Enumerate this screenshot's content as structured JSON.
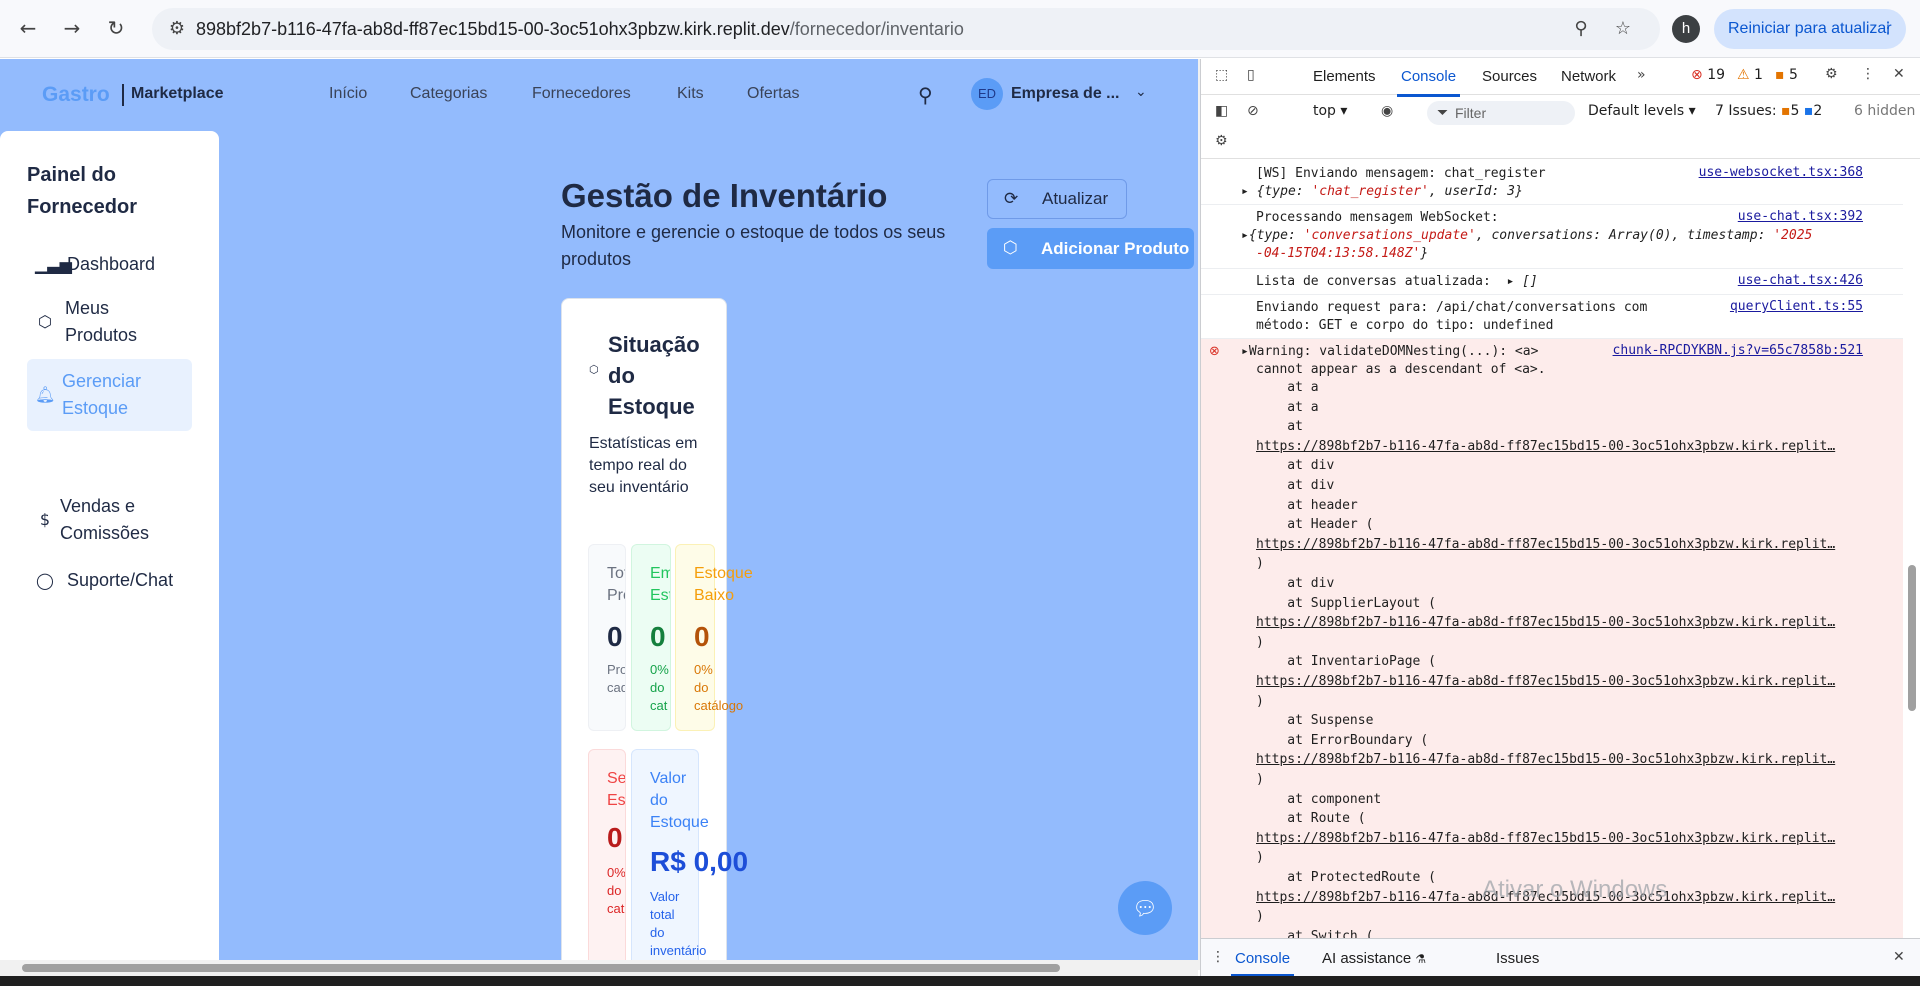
{
  "browser": {
    "url_host": "898bf2b7-b116-47fa-ab8d-ff87ec15bd15-00-3oc51ohx3pbzw.kirk.replit.dev",
    "url_path": "/fornecedor/inventario",
    "profile_initial": "h",
    "update_button": "Reiniciar para atualizar"
  },
  "app": {
    "logo_main": "Gastro",
    "logo_sub": "Marketplace",
    "nav": [
      "Início",
      "Categorias",
      "Fornecedores",
      "Kits",
      "Ofertas"
    ],
    "user_initials": "ED",
    "company": "Empresa de ..."
  },
  "sidebar": {
    "title": "Painel do Fornecedor",
    "items": [
      {
        "label": "Dashboard",
        "icon": "bar-chart-icon"
      },
      {
        "label": "Meus Produtos",
        "icon": "package-icon"
      },
      {
        "label": "Gerenciar Estoque",
        "icon": "bell-icon",
        "active": true
      },
      {
        "label": "Vendas e Comissões",
        "icon": "dollar-icon"
      },
      {
        "label": "Suporte/Chat",
        "icon": "chat-icon"
      }
    ]
  },
  "main": {
    "title": "Gestão de Inventário",
    "subtitle": "Monitore e gerencie o estoque de todos os seus produtos",
    "refresh_label": "Atualizar",
    "add_label": "Adicionar Produto",
    "card_title": "Situação do Estoque",
    "card_desc": "Estatísticas em tempo real do seu inventário",
    "stats": [
      {
        "title_l1": "Tot",
        "title_l2": "Pro",
        "value": "0",
        "desc_l1": "Pro",
        "desc_l2": "cad"
      },
      {
        "title_l1": "Em",
        "title_l2": "Est",
        "value": "0",
        "desc_l1": "0%",
        "desc_l2": "do",
        "desc_l3": "cat"
      },
      {
        "title_l1": "Estoque",
        "title_l2": "Baixo",
        "value": "0",
        "desc_l1": "0%",
        "desc_l2": "do",
        "desc_l3": "catálogo"
      },
      {
        "title_l1": "Ser",
        "title_l2": "Est",
        "value": "0",
        "desc_l1": "0%",
        "desc_l2": "do",
        "desc_l3": "cat"
      },
      {
        "title_l1": "Valor",
        "title_l2": "do",
        "title_l3": "Estoque",
        "value": "R$ 0,00",
        "desc_l1": "Valor",
        "desc_l2": "total",
        "desc_l3": "do",
        "desc_l4": "inventário"
      }
    ]
  },
  "devtools": {
    "tabs": [
      "Elements",
      "Console",
      "Sources",
      "Network"
    ],
    "errors": "19",
    "warnings": "1",
    "info": "5",
    "context": "top",
    "filter_placeholder": "Filter",
    "levels": "Default levels",
    "issues_label": "7 Issues:",
    "issues_a": "5",
    "issues_b": "2",
    "hidden": "6 hidden",
    "logs": {
      "l1": "[WS] Enviando mensagem: chat_register",
      "l1_src": "use-websocket.tsx:368",
      "l1_obj_a": "{type: ",
      "l1_obj_b": "'chat_register'",
      "l1_obj_c": ", userId: 3}",
      "l2": "Processando mensagem WebSocket:",
      "l2_src": "use-chat.tsx:392",
      "l2_obj_a": "{type: ",
      "l2_obj_b": "'conversations_update'",
      "l2_obj_c": ", conversations: Array(0), timestamp: ",
      "l2_obj_d": "'2025",
      "l2_obj_e": "-04-15T04:13:58.148Z'",
      "l2_obj_f": "}",
      "l3": "Lista de conversas atualizada:  ",
      "l3_arr": "[]",
      "l3_src": "use-chat.tsx:426",
      "l4a": "Enviando request para: /api/chat/conversations com",
      "l4b": "método: GET e corpo do tipo: undefined",
      "l4_src": "queryClient.ts:55",
      "w_head": "Warning: validateDOMNesting(...): <a>",
      "w_head2": "cannot appear as a descendant of <a>.",
      "w_src": "chunk-RPCDYKBN.js?v=65c7858b:521",
      "stack": [
        "    at a",
        "    at a",
        "    at",
        "@https://898bf2b7-b116-47fa-ab8d-ff87ec15bd15-00-3oc51ohx3pbzw.kirk.replit…",
        "    at div",
        "    at div",
        "    at header",
        "    at Header (",
        "@https://898bf2b7-b116-47fa-ab8d-ff87ec15bd15-00-3oc51ohx3pbzw.kirk.replit…",
        ")",
        "    at div",
        "    at SupplierLayout (",
        "@https://898bf2b7-b116-47fa-ab8d-ff87ec15bd15-00-3oc51ohx3pbzw.kirk.replit…",
        ")",
        "    at InventarioPage (",
        "@https://898bf2b7-b116-47fa-ab8d-ff87ec15bd15-00-3oc51ohx3pbzw.kirk.replit…",
        ")",
        "    at Suspense",
        "    at ErrorBoundary (",
        "@https://898bf2b7-b116-47fa-ab8d-ff87ec15bd15-00-3oc51ohx3pbzw.kirk.replit…",
        ")",
        "    at component",
        "    at Route (",
        "@https://898bf2b7-b116-47fa-ab8d-ff87ec15bd15-00-3oc51ohx3pbzw.kirk.replit…",
        ")",
        "    at ProtectedRoute (",
        "@https://898bf2b7-b116-47fa-ab8d-ff87ec15bd15-00-3oc51ohx3pbzw.kirk.replit…",
        ")",
        "    at Switch (",
        "@https://898bf2b7-b116-47fa-ab8d-ff87ec15bd15-00-3oc51ohx3pbzw.kirk.replit…"
      ]
    },
    "drawer_tabs": [
      "Console",
      "AI assistance",
      "Issues"
    ]
  },
  "watermark": "Ativar o Windows"
}
